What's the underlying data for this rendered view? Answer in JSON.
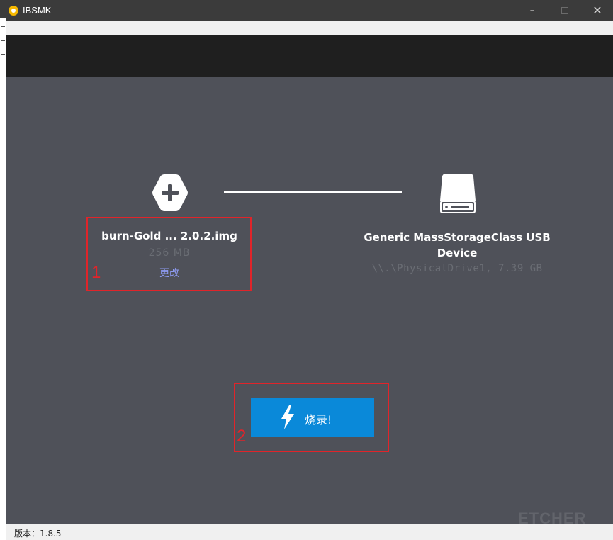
{
  "window": {
    "title": "IBSMK",
    "minimize_glyph": "–",
    "close_glyph": "✕"
  },
  "image": {
    "name": "burn-Gold ... 2.0.2.img",
    "size": "256 MB",
    "change_label": "更改"
  },
  "drive": {
    "name": "Generic MassStorageClass USB Device",
    "info": "\\\\.\\PhysicalDrive1, 7.39 GB"
  },
  "flash_button": {
    "label": "烧录!"
  },
  "annotations": {
    "box1_number": "1",
    "box2_number": "2",
    "color": "#e0242a"
  },
  "watermark": "ETCHER",
  "status_bar": {
    "version_text": "版本：1.8.5"
  },
  "colors": {
    "main_background": "#4f5159",
    "accent": "#0a89d9",
    "link": "#8e9bf2"
  },
  "icons": {
    "app": "app-logo-icon",
    "select_image": "plus-hexagon-icon",
    "drive": "drive-icon",
    "flash": "lightning-bolt-icon"
  }
}
